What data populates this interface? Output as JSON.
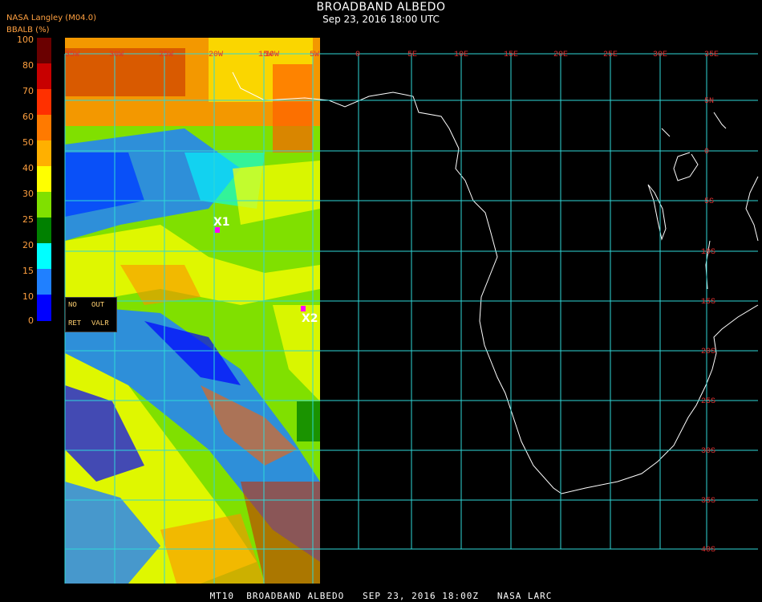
{
  "title": "BROADBAND ALBEDO",
  "subtitle": "Sep 23, 2016 18:00 UTC",
  "credit": "NASA Langley (M04.0)",
  "colorbar": {
    "label": "BBALB (%)",
    "ticks": [
      "100",
      "80",
      "70",
      "60",
      "50",
      "40",
      "30",
      "25",
      "20",
      "15",
      "10",
      "0"
    ],
    "colors": [
      "#6a0000",
      "#c80000",
      "#ff3000",
      "#ff7a00",
      "#ffb000",
      "#ffff00",
      "#80e000",
      "#008000",
      "#00ffff",
      "#2080ff",
      "#0000ff",
      "#8020d0"
    ]
  },
  "lon_labels": [
    "35W",
    "30W",
    "25W",
    "20W",
    "15W",
    "10W",
    "5W",
    "0",
    "5E",
    "10E",
    "15E",
    "20E",
    "25E",
    "30E",
    "35E"
  ],
  "lat_labels": [
    "5N",
    "0",
    "5S",
    "10S",
    "15S",
    "20S",
    "25S",
    "30S",
    "35S",
    "40S"
  ],
  "points": [
    {
      "label": "X1"
    },
    {
      "label": "X2"
    }
  ],
  "legend_box": {
    "no": "NO",
    "out": "OUT",
    "ret": "RET",
    "valr": "VALR"
  },
  "footer": "MT10  BROADBAND ALBEDO   SEP 23, 2016 18:00Z   NASA LARC"
}
